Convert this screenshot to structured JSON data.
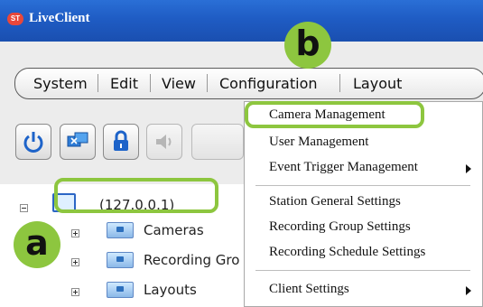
{
  "window": {
    "title": "LiveClient",
    "app_icon_text": "ST"
  },
  "menubar": {
    "items": [
      "System",
      "Edit",
      "View",
      "Configuration",
      "Layout"
    ]
  },
  "toolbar": {
    "icons": [
      "power-icon",
      "monitor-sync-icon",
      "lock-icon",
      "speaker-icon"
    ]
  },
  "tree": {
    "root": "(127.0.0.1)",
    "children": [
      "Cameras",
      "Recording Gro",
      "Layouts"
    ]
  },
  "dropdown": {
    "items": [
      {
        "label": "Camera Management",
        "submenu": false
      },
      {
        "label": "User Management",
        "submenu": false
      },
      {
        "label": "Event Trigger Management",
        "submenu": true
      },
      {
        "label": "Station General Settings",
        "submenu": false
      },
      {
        "label": "Recording Group Settings",
        "submenu": false
      },
      {
        "label": "Recording Schedule Settings",
        "submenu": false
      },
      {
        "label": "Client Settings",
        "submenu": true
      }
    ]
  },
  "annotations": {
    "a": "a",
    "b": "b"
  },
  "colors": {
    "accent_green": "#8dc63f",
    "titlebar_blue": "#1f5cc4"
  }
}
